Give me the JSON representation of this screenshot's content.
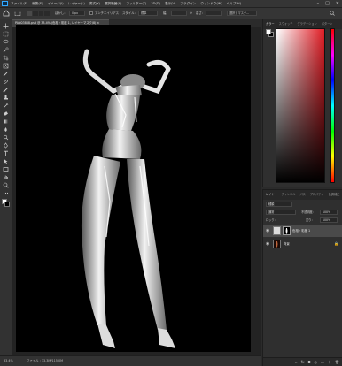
{
  "menubar": {
    "items": [
      "ファイル(F)",
      "編集(E)",
      "イメージ(I)",
      "レイヤー(L)",
      "書式(Y)",
      "選択範囲(S)",
      "フィルター(T)",
      "3D(D)",
      "表示(V)",
      "プラグイン",
      "ウィンドウ(W)",
      "ヘルプ(H)"
    ],
    "window_buttons": [
      "–",
      "□",
      "✕"
    ]
  },
  "options": {
    "feather_label": "ぼかし：",
    "feather_value": "0 px",
    "antialias_label": "アンチエイリアス",
    "style_label": "スタイル：",
    "style_value": "標準",
    "width_label": "幅：",
    "height_label": "高さ：",
    "select_mask_label": "選択とマスク..."
  },
  "document": {
    "tab_title": "PAN03888.psd @ 33.4% (色相・彩度 1, レイヤーマスク/8) ×"
  },
  "status": {
    "zoom": "33.4%",
    "doc_info": "ファイル : 33.3M/115.0M"
  },
  "color_panel": {
    "tabs": [
      "カラー",
      "スウォッチ",
      "グラデーション",
      "パターン"
    ],
    "colors": {
      "fg": "#ffffff",
      "bg": "#000000",
      "picked_hue": "#e11d25"
    }
  },
  "layers_panel": {
    "tabs": [
      "レイヤー",
      "チャンネル",
      "パス",
      "プロパティ",
      "色調補正"
    ],
    "search_value": "種類",
    "blend_mode": "通常",
    "opacity_label": "不透明度：",
    "opacity_value": "100%",
    "lock_label": "ロック：",
    "fill_label": "塗り：",
    "fill_value": "100%",
    "layers": [
      {
        "name": "色相・彩度 1",
        "visible": true,
        "selected": true
      },
      {
        "name": "背景",
        "visible": true,
        "selected": false
      }
    ]
  }
}
